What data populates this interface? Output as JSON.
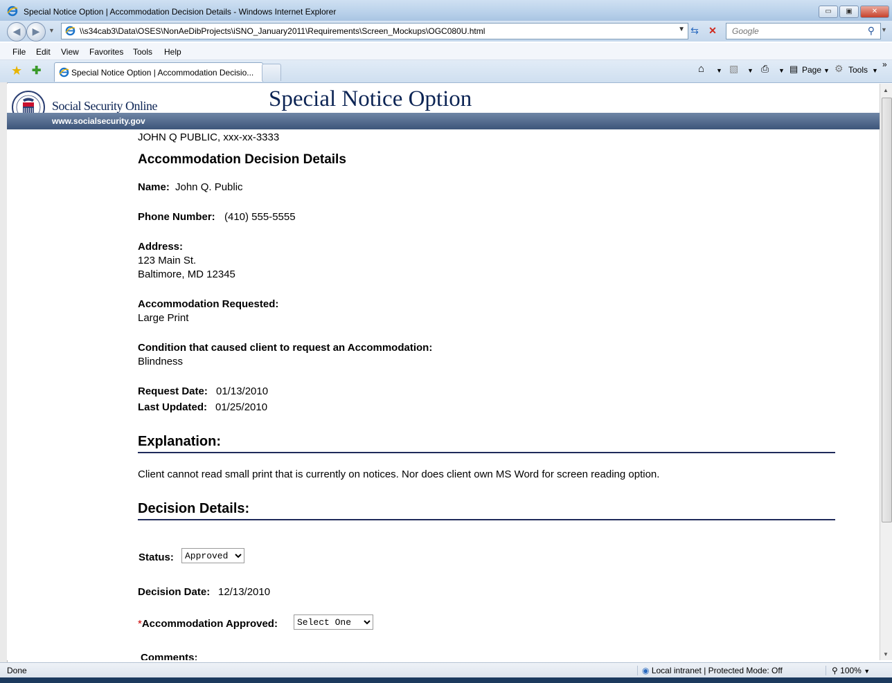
{
  "window": {
    "title": "Special Notice Option | Accommodation Decision Details - Windows Internet Explorer",
    "controls": [
      "▭",
      "▣",
      "✕"
    ]
  },
  "nav": {
    "address": "\\\\s34cab3\\Data\\OSES\\NonAeDibProjects\\iSNO_January2011\\Requirements\\Screen_Mockups\\OGC080U.html",
    "search_placeholder": "Google"
  },
  "menu": [
    "File",
    "Edit",
    "View",
    "Favorites",
    "Tools",
    "Help"
  ],
  "tabs": {
    "active_label": "Special Notice Option | Accommodation Decisio..."
  },
  "command_bar": {
    "page_label": "Page",
    "tools_label": "Tools"
  },
  "header": {
    "site_name": "Social Security Online",
    "page_title": "Special Notice Option",
    "url": "www.socialsecurity.gov"
  },
  "content": {
    "person_line": "JOHN Q PUBLIC, xxx-xx-3333",
    "section_title": "Accommodation Decision Details",
    "name_label": "Name:",
    "name_value": "John Q. Public",
    "phone_label": "Phone Number:",
    "phone_value": "(410) 555-5555",
    "address_label": "Address:",
    "address_line1": "123 Main St.",
    "address_line2": "Baltimore, MD 12345",
    "accom_req_label": "Accommodation Requested:",
    "accom_req_value": "Large Print",
    "condition_label": "Condition that caused client to request an Accommodation:",
    "condition_value": "Blindness",
    "request_date_label": "Request Date:",
    "request_date_value": "01/13/2010",
    "last_updated_label": "Last Updated:",
    "last_updated_value": "01/25/2010",
    "explanation_heading": "Explanation:",
    "explanation_text": "Client cannot read small print that is currently on notices. Nor does client own MS Word for screen reading option.",
    "decision_heading": "Decision Details:",
    "status_label": "Status:",
    "status_value": "Approved",
    "decision_date_label": "Decision Date:",
    "decision_date_value": "12/13/2010",
    "required_mark": "*",
    "accom_approved_label": "Accommodation Approved:",
    "accom_approved_value": "Select One",
    "comments_label": "Comments:"
  },
  "status_bar": {
    "left": "Done",
    "zone": "Local intranet | Protected Mode: Off",
    "zoom": "100%"
  }
}
